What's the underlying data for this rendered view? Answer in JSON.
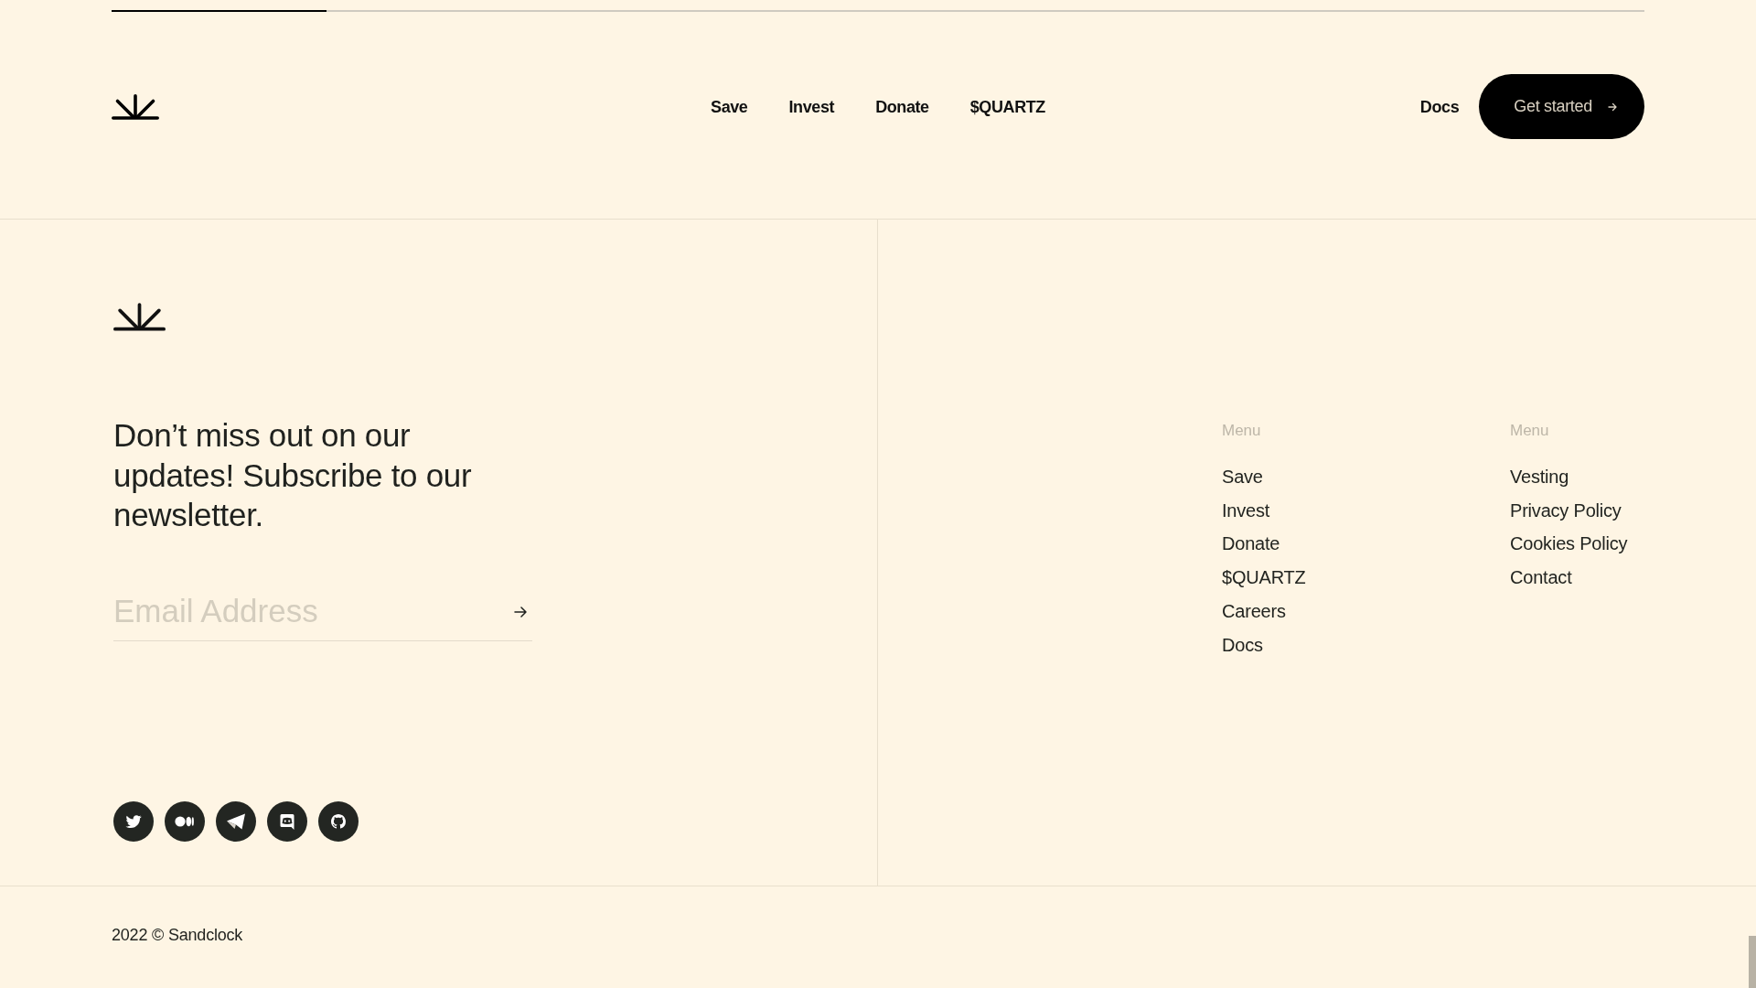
{
  "progress": {
    "level": 0.14
  },
  "nav": {
    "links": [
      "Save",
      "Invest",
      "Donate",
      "$QUARTZ"
    ],
    "docs": "Docs",
    "cta": "Get started"
  },
  "newsletter": {
    "heading": "Don’t miss out on our updates! Subscribe to our newsletter.",
    "email": {
      "placeholder": "Email Address"
    }
  },
  "socials": [
    {
      "kind": "bird"
    },
    {
      "kind": "ovals"
    },
    {
      "kind": "plane"
    },
    {
      "kind": "chat"
    },
    {
      "kind": "cat"
    }
  ],
  "menus": [
    {
      "heading": "Menu",
      "items": [
        "Save",
        "Invest",
        "Donate",
        "$QUARTZ",
        "Careers",
        "Docs"
      ]
    },
    {
      "heading": "Menu",
      "items": [
        "Vesting",
        "Privacy Policy",
        "Cookies Policy",
        "Contact"
      ]
    }
  ],
  "copyright": "2022 © Sandclock"
}
